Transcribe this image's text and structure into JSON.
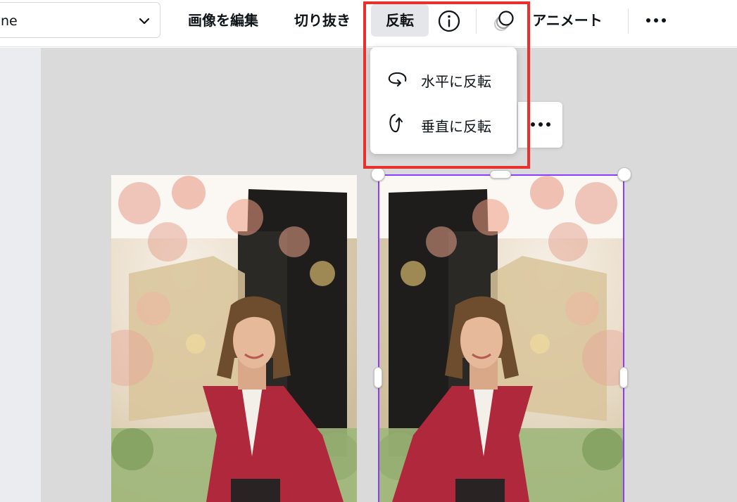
{
  "toolbar": {
    "font_value": "ne",
    "edit_image_label": "画像を編集",
    "crop_label": "切り抜き",
    "flip_label": "反転",
    "animate_label": "アニメート"
  },
  "flip_menu": {
    "items": [
      {
        "label": "水平に反転",
        "icon": "flip-horizontal-icon"
      },
      {
        "label": "垂直に反転",
        "icon": "flip-vertical-icon"
      }
    ]
  },
  "colors": {
    "selection": "#8b3dff",
    "annotation_box": "#e8302c",
    "canvas_bg": "#dadada",
    "active_button_bg": "#e4e6e9"
  }
}
